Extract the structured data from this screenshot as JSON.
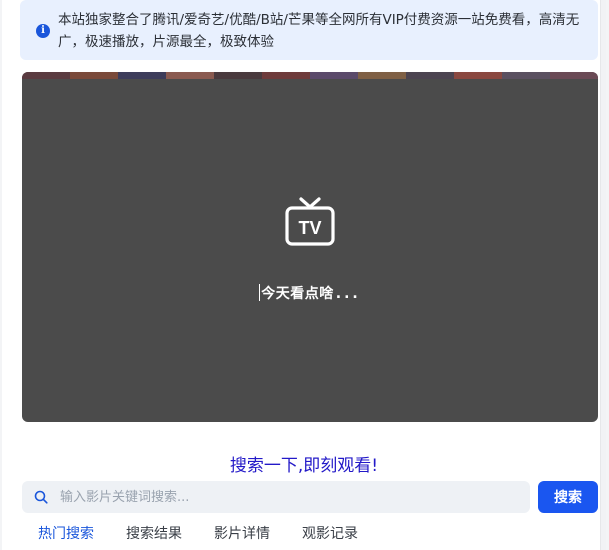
{
  "notice": {
    "icon": "info-icon",
    "text": "本站独家整合了腾讯/爱奇艺/优酷/B站/芒果等全网所有VIP付费资源一站免费看，高清无广，极速播放，片源最全，极致体验"
  },
  "player": {
    "icon": "tv-icon",
    "icon_text": "TV",
    "prompt": "今天看点啥",
    "dots": "..."
  },
  "slogan": "搜索一下,即刻观看!",
  "search": {
    "icon": "search-icon",
    "placeholder": "输入影片关键词搜索...",
    "value": "",
    "button_label": "搜索"
  },
  "tabs": [
    {
      "label": "热门搜索",
      "active": true
    },
    {
      "label": "搜索结果",
      "active": false
    },
    {
      "label": "影片详情",
      "active": false
    },
    {
      "label": "观影记录",
      "active": false
    }
  ],
  "colors": {
    "accent": "#1a56f0",
    "slogan": "#2319c8",
    "player_bg": "#4b4b4b",
    "notice_bg": "#e8f0fe"
  }
}
